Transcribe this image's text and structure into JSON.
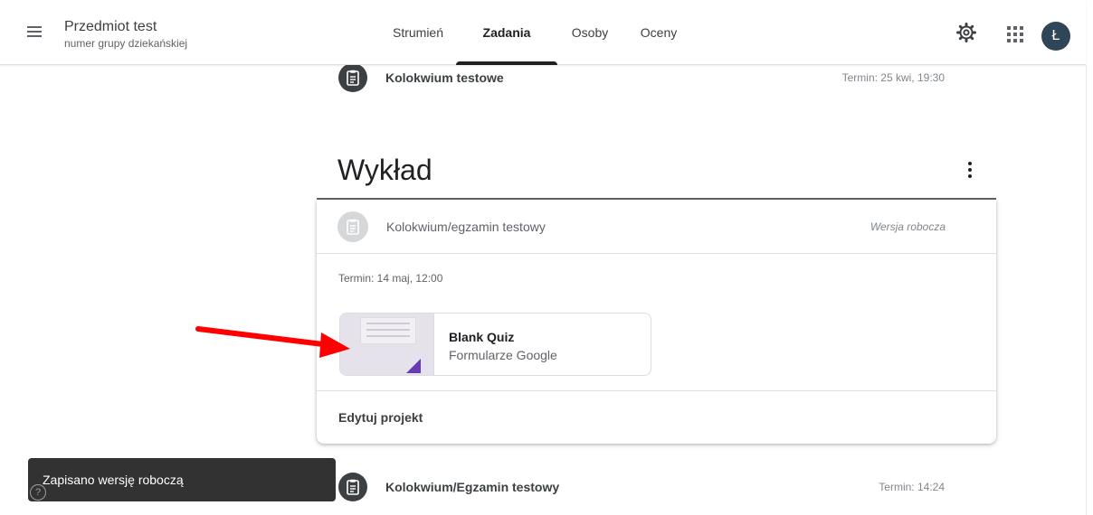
{
  "header": {
    "course_title": "Przedmiot test",
    "course_subtitle": "numer grupy dziekańskiej",
    "tabs": [
      {
        "label": "Strumień"
      },
      {
        "label": "Zadania"
      },
      {
        "label": "Osoby"
      },
      {
        "label": "Oceny"
      }
    ],
    "active_tab": "Zadania",
    "avatar_letter": "Ł"
  },
  "assignments_above": [
    {
      "title": "Kolokwium testowe",
      "due": "Termin: 25 kwi, 19:30"
    }
  ],
  "topic": {
    "title": "Wykład",
    "card": {
      "title": "Kolokwium/egzamin testowy",
      "status": "Wersja robocza",
      "due": "Termin: 14 maj, 12:00",
      "attachment": {
        "title": "Blank Quiz",
        "type": "Formularze Google"
      },
      "edit_label": "Edytuj projekt"
    }
  },
  "assignments_below": [
    {
      "title": "Kolokwium/Egzamin testowy",
      "due": "Termin: 14:24"
    }
  ],
  "snackbar": {
    "message": "Zapisano wersję roboczą",
    "help_icon": "?"
  },
  "colors": {
    "accent_dark": "#202124",
    "forms_purple": "#673ab7",
    "arrow_red": "#ff0000",
    "snackbar_bg": "#323232"
  }
}
